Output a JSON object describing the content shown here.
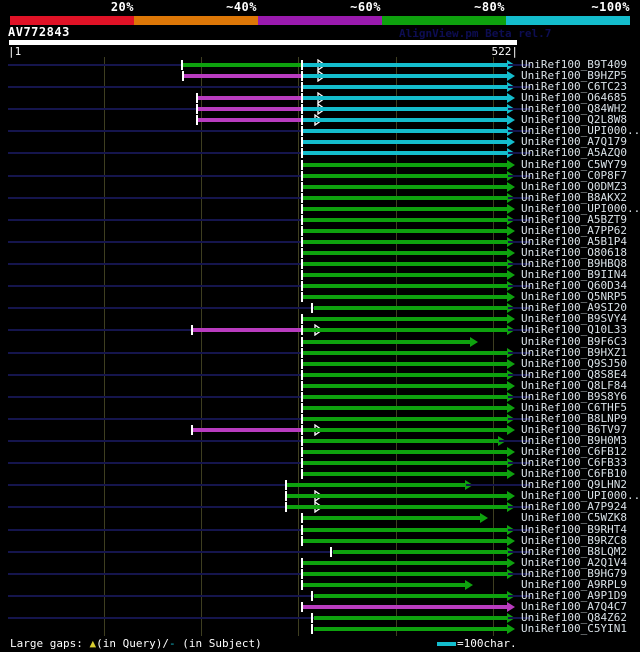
{
  "colors": {
    "background": "#000000",
    "red": "#e01226",
    "orange": "#dd7707",
    "purple": "#9a1aae",
    "green": "#0ea10e",
    "cyan": "#14bdcd",
    "magenta": "#b93cbf",
    "guide": "#15154d",
    "grid": "#3e3e20",
    "tick": "#ffffff",
    "label": "#d9e2e8",
    "watermark": "#0d0d52",
    "gap_symbol_yellow": "#d8cc30"
  },
  "chart_data": {
    "type": "bar",
    "title": "AV772843",
    "subtitle_watermark": "AlignView.pm Beta rel.7",
    "x_axis": {
      "min": 1,
      "max": 522,
      "start_label": "|1",
      "end_label": "522|",
      "gridline_residues": [
        100,
        200,
        300,
        400,
        500
      ]
    },
    "identity_scale": [
      {
        "label": "20%",
        "color": "#e01226"
      },
      {
        "label": "~40%",
        "color": "#dd7707"
      },
      {
        "label": "~60%",
        "color": "#9a1aae"
      },
      {
        "label": "~80%",
        "color": "#0ea10e"
      },
      {
        "label": "~100%",
        "color": "#14bdcd"
      }
    ],
    "legend": {
      "label": "Large gaps: ",
      "query_symbol": "▲",
      "query_symbol_color": "#d8cc30",
      "query_text": "(in Query)/",
      "subject_symbol": "-",
      "subject_symbol_color": "#14bdcd",
      "subject_text": " (in Subject)",
      "ruler_color": "#14bdcd",
      "ruler_text": "=100char."
    },
    "rows": [
      {
        "label": "UniRef100_B9T409",
        "guide": true,
        "segments": [
          [
            180,
            303,
            "green"
          ],
          [
            303,
            522,
            "cyan"
          ]
        ],
        "ticks": [
          180,
          303
        ],
        "gap_markers": [
          322
        ]
      },
      {
        "label": "UniRef100_B9HZP5",
        "guide": false,
        "segments": [
          [
            181,
            303,
            "magenta"
          ],
          [
            303,
            522,
            "cyan"
          ]
        ],
        "ticks": [
          181,
          303
        ],
        "gap_markers": [
          322
        ]
      },
      {
        "label": "UniRef100_C6TC23",
        "guide": true,
        "segments": [
          [
            303,
            522,
            "cyan"
          ]
        ],
        "ticks": [
          303
        ],
        "gap_markers": []
      },
      {
        "label": "UniRef100_O64685",
        "guide": false,
        "segments": [
          [
            195,
            303,
            "magenta"
          ],
          [
            303,
            522,
            "cyan"
          ]
        ],
        "ticks": [
          195,
          303
        ],
        "gap_markers": [
          322
        ]
      },
      {
        "label": "UniRef100_Q84WH2",
        "guide": true,
        "segments": [
          [
            195,
            303,
            "magenta"
          ],
          [
            303,
            522,
            "cyan"
          ]
        ],
        "ticks": [
          195,
          303
        ],
        "gap_markers": [
          322
        ]
      },
      {
        "label": "UniRef100_Q2L8W8",
        "guide": false,
        "segments": [
          [
            195,
            303,
            "magenta"
          ],
          [
            303,
            522,
            "cyan"
          ]
        ],
        "ticks": [
          195,
          303
        ],
        "gap_markers": [
          319
        ]
      },
      {
        "label": "UniRef100_UPI000..",
        "guide": true,
        "segments": [
          [
            303,
            522,
            "cyan"
          ]
        ],
        "ticks": [
          303
        ],
        "gap_markers": []
      },
      {
        "label": "UniRef100_A7Q179",
        "guide": false,
        "segments": [
          [
            303,
            522,
            "cyan"
          ]
        ],
        "ticks": [
          303
        ],
        "gap_markers": []
      },
      {
        "label": "UniRef100_A5AZQ0",
        "guide": true,
        "segments": [
          [
            303,
            522,
            "cyan"
          ]
        ],
        "ticks": [
          303
        ],
        "gap_markers": []
      },
      {
        "label": "UniRef100_C5WY79",
        "guide": false,
        "segments": [
          [
            303,
            522,
            "green"
          ]
        ],
        "ticks": [
          303
        ],
        "gap_markers": []
      },
      {
        "label": "UniRef100_C0P8F7",
        "guide": true,
        "segments": [
          [
            303,
            522,
            "green"
          ]
        ],
        "ticks": [
          303
        ],
        "gap_markers": []
      },
      {
        "label": "UniRef100_Q0DMZ3",
        "guide": false,
        "segments": [
          [
            303,
            522,
            "green"
          ]
        ],
        "ticks": [
          303
        ],
        "gap_markers": []
      },
      {
        "label": "UniRef100_B8AKX2",
        "guide": true,
        "segments": [
          [
            303,
            522,
            "green"
          ]
        ],
        "ticks": [
          303
        ],
        "gap_markers": []
      },
      {
        "label": "UniRef100_UPI000..",
        "guide": false,
        "segments": [
          [
            303,
            522,
            "green"
          ]
        ],
        "ticks": [
          303
        ],
        "gap_markers": []
      },
      {
        "label": "UniRef100_A5BZT9",
        "guide": true,
        "segments": [
          [
            303,
            522,
            "green"
          ]
        ],
        "ticks": [
          303
        ],
        "gap_markers": []
      },
      {
        "label": "UniRef100_A7PP62",
        "guide": false,
        "segments": [
          [
            303,
            522,
            "green"
          ]
        ],
        "ticks": [
          303
        ],
        "gap_markers": []
      },
      {
        "label": "UniRef100_A5B1P4",
        "guide": true,
        "segments": [
          [
            303,
            522,
            "green"
          ]
        ],
        "ticks": [
          303
        ],
        "gap_markers": []
      },
      {
        "label": "UniRef100_O80618",
        "guide": false,
        "segments": [
          [
            303,
            522,
            "green"
          ]
        ],
        "ticks": [
          303
        ],
        "gap_markers": []
      },
      {
        "label": "UniRef100_B9HBQ8",
        "guide": true,
        "segments": [
          [
            303,
            522,
            "green"
          ]
        ],
        "ticks": [
          303
        ],
        "gap_markers": []
      },
      {
        "label": "UniRef100_B9IIN4",
        "guide": false,
        "segments": [
          [
            303,
            522,
            "green"
          ]
        ],
        "ticks": [
          303
        ],
        "gap_markers": []
      },
      {
        "label": "UniRef100_Q60D34",
        "guide": true,
        "segments": [
          [
            303,
            522,
            "green"
          ]
        ],
        "ticks": [
          303
        ],
        "gap_markers": []
      },
      {
        "label": "UniRef100_Q5NRP5",
        "guide": false,
        "segments": [
          [
            303,
            522,
            "green"
          ]
        ],
        "ticks": [
          303
        ],
        "gap_markers": []
      },
      {
        "label": "UniRef100_A9SI20",
        "guide": true,
        "segments": [
          [
            315,
            522,
            "green"
          ]
        ],
        "ticks": [
          313
        ],
        "gap_markers": []
      },
      {
        "label": "UniRef100_B9SVY4",
        "guide": false,
        "segments": [
          [
            303,
            522,
            "green"
          ]
        ],
        "ticks": [
          303
        ],
        "gap_markers": []
      },
      {
        "label": "UniRef100_Q10L33",
        "guide": true,
        "segments": [
          [
            190,
            303,
            "magenta"
          ],
          [
            303,
            522,
            "green"
          ]
        ],
        "ticks": [
          190,
          303
        ],
        "gap_markers": [
          319
        ]
      },
      {
        "label": "UniRef100_B9F6C3",
        "guide": false,
        "segments": [
          [
            303,
            484,
            "green"
          ]
        ],
        "ticks": [
          303
        ],
        "gap_markers": []
      },
      {
        "label": "UniRef100_B9HXZ1",
        "guide": true,
        "segments": [
          [
            303,
            522,
            "green"
          ]
        ],
        "ticks": [
          303
        ],
        "gap_markers": []
      },
      {
        "label": "UniRef100_Q9SJ50",
        "guide": false,
        "segments": [
          [
            303,
            522,
            "green"
          ]
        ],
        "ticks": [
          303
        ],
        "gap_markers": []
      },
      {
        "label": "UniRef100_Q8S8E4",
        "guide": true,
        "segments": [
          [
            303,
            522,
            "green"
          ]
        ],
        "ticks": [
          303
        ],
        "gap_markers": []
      },
      {
        "label": "UniRef100_Q8LF84",
        "guide": false,
        "segments": [
          [
            303,
            522,
            "green"
          ]
        ],
        "ticks": [
          303
        ],
        "gap_markers": []
      },
      {
        "label": "UniRef100_B9S8Y6",
        "guide": true,
        "segments": [
          [
            303,
            522,
            "green"
          ]
        ],
        "ticks": [
          303
        ],
        "gap_markers": []
      },
      {
        "label": "UniRef100_C6THF5",
        "guide": false,
        "segments": [
          [
            303,
            522,
            "green"
          ]
        ],
        "ticks": [
          303
        ],
        "gap_markers": []
      },
      {
        "label": "UniRef100_B8LNP9",
        "guide": true,
        "segments": [
          [
            303,
            522,
            "green"
          ]
        ],
        "ticks": [
          303
        ],
        "gap_markers": []
      },
      {
        "label": "UniRef100_B6TV97",
        "guide": false,
        "segments": [
          [
            190,
            303,
            "magenta"
          ],
          [
            303,
            522,
            "green"
          ]
        ],
        "ticks": [
          190,
          303
        ],
        "gap_markers": [
          319
        ]
      },
      {
        "label": "UniRef100_B9H0M3",
        "guide": true,
        "segments": [
          [
            303,
            513,
            "green"
          ]
        ],
        "ticks": [
          303
        ],
        "gap_markers": []
      },
      {
        "label": "UniRef100_C6FB12",
        "guide": false,
        "segments": [
          [
            303,
            522,
            "green"
          ]
        ],
        "ticks": [
          303
        ],
        "gap_markers": []
      },
      {
        "label": "UniRef100_C6FB33",
        "guide": true,
        "segments": [
          [
            303,
            522,
            "green"
          ]
        ],
        "ticks": [
          303
        ],
        "gap_markers": []
      },
      {
        "label": "UniRef100_C6FB10",
        "guide": false,
        "segments": [
          [
            303,
            522,
            "green"
          ]
        ],
        "ticks": [
          303
        ],
        "gap_markers": []
      },
      {
        "label": "UniRef100_Q9LHN2",
        "guide": true,
        "segments": [
          [
            288,
            479,
            "green"
          ]
        ],
        "ticks": [
          287
        ],
        "gap_markers": []
      },
      {
        "label": "UniRef100_UPI000..",
        "guide": false,
        "segments": [
          [
            288,
            522,
            "green"
          ]
        ],
        "ticks": [
          287
        ],
        "gap_markers": [
          319
        ]
      },
      {
        "label": "UniRef100_A7P924",
        "guide": true,
        "segments": [
          [
            288,
            522,
            "green"
          ]
        ],
        "ticks": [
          287
        ],
        "gap_markers": [
          319
        ]
      },
      {
        "label": "UniRef100_C5WZK8",
        "guide": false,
        "segments": [
          [
            303,
            494,
            "green"
          ]
        ],
        "ticks": [
          303
        ],
        "gap_markers": []
      },
      {
        "label": "UniRef100_B9RHT4",
        "guide": true,
        "segments": [
          [
            303,
            522,
            "green"
          ]
        ],
        "ticks": [
          303
        ],
        "gap_markers": []
      },
      {
        "label": "UniRef100_B9RZC8",
        "guide": false,
        "segments": [
          [
            303,
            522,
            "green"
          ]
        ],
        "ticks": [
          303
        ],
        "gap_markers": []
      },
      {
        "label": "UniRef100_B8LQM2",
        "guide": true,
        "segments": [
          [
            335,
            522,
            "green"
          ]
        ],
        "ticks": [
          333
        ],
        "gap_markers": []
      },
      {
        "label": "UniRef100_A2Q1V4",
        "guide": false,
        "segments": [
          [
            303,
            522,
            "green"
          ]
        ],
        "ticks": [
          303
        ],
        "gap_markers": []
      },
      {
        "label": "UniRef100_B9HG79",
        "guide": true,
        "segments": [
          [
            303,
            522,
            "green"
          ]
        ],
        "ticks": [
          303
        ],
        "gap_markers": []
      },
      {
        "label": "UniRef100_A9RPL9",
        "guide": false,
        "segments": [
          [
            303,
            479,
            "green"
          ]
        ],
        "ticks": [
          303
        ],
        "gap_markers": []
      },
      {
        "label": "UniRef100_A9P1D9",
        "guide": true,
        "segments": [
          [
            315,
            522,
            "green"
          ]
        ],
        "ticks": [
          313
        ],
        "gap_markers": []
      },
      {
        "label": "UniRef100_A7Q4C7",
        "guide": false,
        "segments": [
          [
            303,
            522,
            "magenta"
          ]
        ],
        "ticks": [
          303
        ],
        "gap_markers": []
      },
      {
        "label": "UniRef100_Q84Z62",
        "guide": true,
        "segments": [
          [
            315,
            522,
            "green"
          ]
        ],
        "ticks": [
          313
        ],
        "gap_markers": []
      },
      {
        "label": "UniRef100_C5YIN1",
        "guide": false,
        "segments": [
          [
            315,
            522,
            "green"
          ]
        ],
        "ticks": [
          313
        ],
        "gap_markers": []
      }
    ]
  }
}
